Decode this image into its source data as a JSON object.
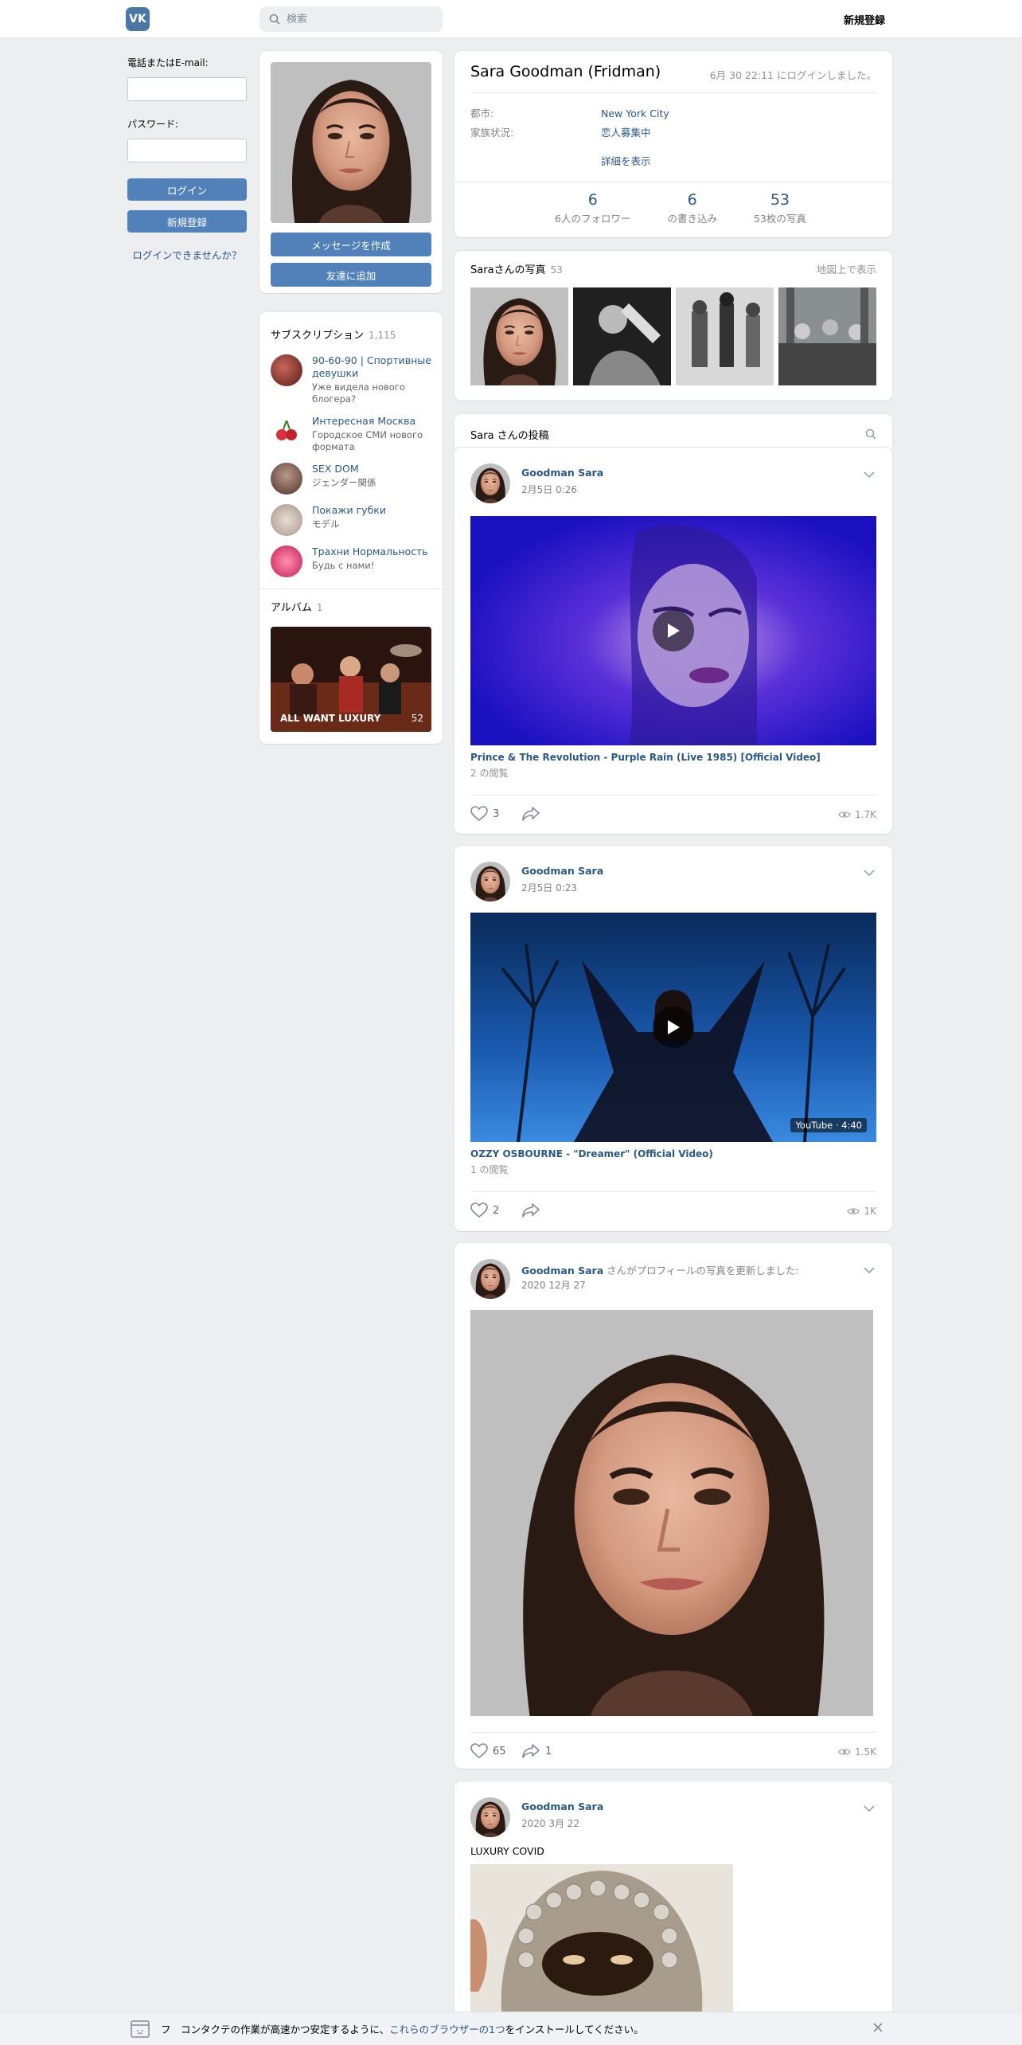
{
  "header": {
    "logo_text": "VK",
    "search_placeholder": "検索",
    "signup_label": "新規登録"
  },
  "login": {
    "email_label": "電話またはE-mail:",
    "password_label": "パスワード:",
    "login_button": "ログイン",
    "signup_button": "新規登録",
    "forgot_link": "ログインできませんか？"
  },
  "profile": {
    "name": "Sara Goodman (Fridman)",
    "last_seen": "6月 30 22:11 にログインしました。",
    "city_label": "都市:",
    "city_value": "New York City",
    "status_label": "家族状況:",
    "status_value": "恋人募集中",
    "more_link": "詳細を表示",
    "message_button": "メッセージを作成",
    "add_friend_button": "友達に追加",
    "counters": [
      {
        "num": "6",
        "label": "6人のフォロワー"
      },
      {
        "num": "6",
        "label": "の書き込み"
      },
      {
        "num": "53",
        "label": "53枚の写真"
      }
    ]
  },
  "photos": {
    "title": "Saraさんの写真",
    "count": "53",
    "map_link": "地図上で表示"
  },
  "subscriptions": {
    "title": "サブスクリプション",
    "count": "1,115",
    "items": [
      {
        "title": "90-60-90 | Спортивные девушки",
        "desc": "Уже видела нового блогера?",
        "color": "#9b3b2e"
      },
      {
        "title": "Интересная Москва",
        "desc": "Городское СМИ нового формата",
        "color": "#d8313c"
      },
      {
        "title": "SEX DOM",
        "desc": "ジェンダー関係",
        "color": "#7a5a50"
      },
      {
        "title": "Покажи губки",
        "desc": "モデル",
        "color": "#b7a89e"
      },
      {
        "title": "Трахни Нормальность",
        "desc": "Будь с нами!",
        "color": "#e0457a"
      }
    ]
  },
  "album": {
    "section_title": "アルバム",
    "section_count": "1",
    "name": "ALL WANT LUXURY",
    "count": "52"
  },
  "wall": {
    "tab_label": "Sara さんの投稿"
  },
  "posts": [
    {
      "author": "Goodman Sara",
      "action": "",
      "date": "2月5日 0:26",
      "video_title": "Prince & The Revolution - Purple Rain (Live 1985) [Official Video]",
      "video_views": "2 の閲覧",
      "duration": "",
      "likes": "3",
      "shares": "",
      "views": "1.7K"
    },
    {
      "author": "Goodman Sara",
      "action": "",
      "date": "2月5日 0:23",
      "video_title": "OZZY OSBOURNE - \"Dreamer\" (Official Video)",
      "video_views": "1 の閲覧",
      "duration": "YouTube · 4:40",
      "likes": "2",
      "shares": "",
      "views": "1K"
    },
    {
      "author": "Goodman Sara",
      "action": " さんがプロフィールの写真を更新しました:",
      "date": "2020 12月 27",
      "likes": "65",
      "shares": "1",
      "views": "1.5K"
    },
    {
      "author": "Goodman Sara",
      "action": "",
      "date": "2020 3月 22",
      "text": "LUXURY COVID"
    }
  ],
  "bottom_bar": {
    "prefix": "フ　コンタクテの作業が高速かつ安定するように、",
    "link": "これらのブラウザーの1つ",
    "suffix": "をインストールしてください。"
  },
  "colors": {
    "accent": "#5181b8",
    "link": "#2a5885",
    "background": "#edeef0"
  }
}
